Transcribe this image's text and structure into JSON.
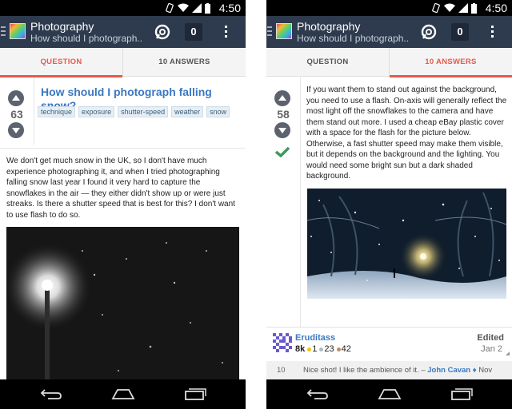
{
  "status": {
    "time": "4:50"
  },
  "left": {
    "app": {
      "title": "Photography",
      "subtitle": "How should I photograph...",
      "inbox_count": "0"
    },
    "tabs": [
      {
        "label": "QUESTION"
      },
      {
        "label": "10 ANSWERS"
      }
    ],
    "question": {
      "votes": "63",
      "title": "How should I photograph falling snow?",
      "tags": [
        "technique",
        "exposure",
        "shutter-speed",
        "weather",
        "snow"
      ],
      "body": "We don't get much snow in the UK, so I don't have much experience photographing it, and when I tried photographing falling snow last year I found it very hard to capture the snowflakes in the air — they either didn't show up or were just streaks. Is there a shutter speed that is best for this? I don't want to use flash to do so."
    }
  },
  "right": {
    "app": {
      "title": "Photography",
      "subtitle": "How should I photograph...",
      "inbox_count": "0"
    },
    "tabs": [
      {
        "label": "QUESTION"
      },
      {
        "label": "10 ANSWERS"
      }
    ],
    "answer": {
      "votes": "58",
      "body": "If you want them to stand out against the background, you need to use a flash. On-axis will generally reflect the most light off the snowflakes to the camera and have them stand out more. I used a cheap eBay plastic cover with a space for the flash for the picture below. Otherwise, a fast shutter speed may make them visible, but it depends on the background and the lighting. You would need some bright sun but a dark shaded background.",
      "user": {
        "name": "Eruditass",
        "rep": "8k",
        "gold": "1",
        "silver": "23",
        "bronze": "42"
      },
      "edited_label": "Edited",
      "edited_date": "Jan 2",
      "comment": {
        "score": "10",
        "text": "Nice shot! I like the ambience of it. –",
        "user": "John Cavan",
        "date": "Nov"
      }
    }
  },
  "colors": {
    "appbar": "#2e3a4d",
    "accent": "#e8594a",
    "link": "#3a78c2",
    "accepted": "#3c9a5f",
    "gold": "#f1c40f",
    "silver": "#b4b8bc",
    "bronze": "#c38b5f"
  }
}
